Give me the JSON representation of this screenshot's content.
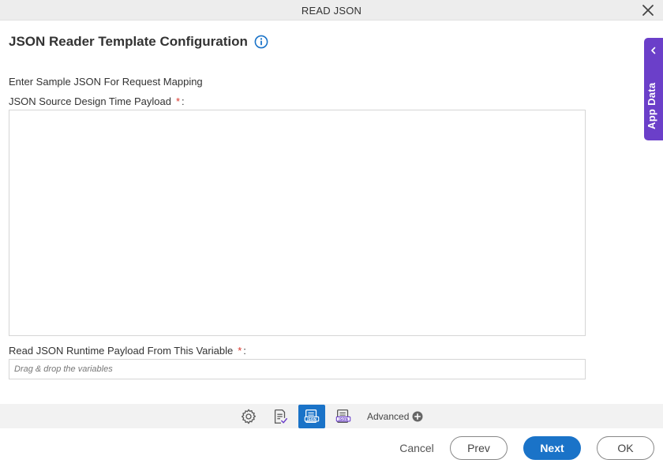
{
  "window": {
    "title": "READ JSON"
  },
  "header": {
    "title": "JSON Reader Template Configuration"
  },
  "form": {
    "section_label": "Enter Sample JSON For Request Mapping",
    "payload_label": "JSON Source Design Time Payload",
    "payload_value": "",
    "variable_label": "Read JSON Runtime Payload From This Variable",
    "variable_placeholder": "Drag & drop the variables",
    "required_mark": "*",
    "colon": ":"
  },
  "side_panel": {
    "label": "App Data"
  },
  "toolbar": {
    "items": [
      {
        "icon": "gear-icon"
      },
      {
        "icon": "checklist-icon"
      },
      {
        "icon": "json-icon",
        "active": true
      },
      {
        "icon": "json-document-icon"
      }
    ],
    "advanced_label": "Advanced"
  },
  "footer": {
    "cancel_label": "Cancel",
    "prev_label": "Prev",
    "next_label": "Next",
    "ok_label": "OK"
  },
  "colors": {
    "accent": "#1a73c8",
    "side_panel": "#6b3fc9",
    "required": "#d9362b"
  }
}
